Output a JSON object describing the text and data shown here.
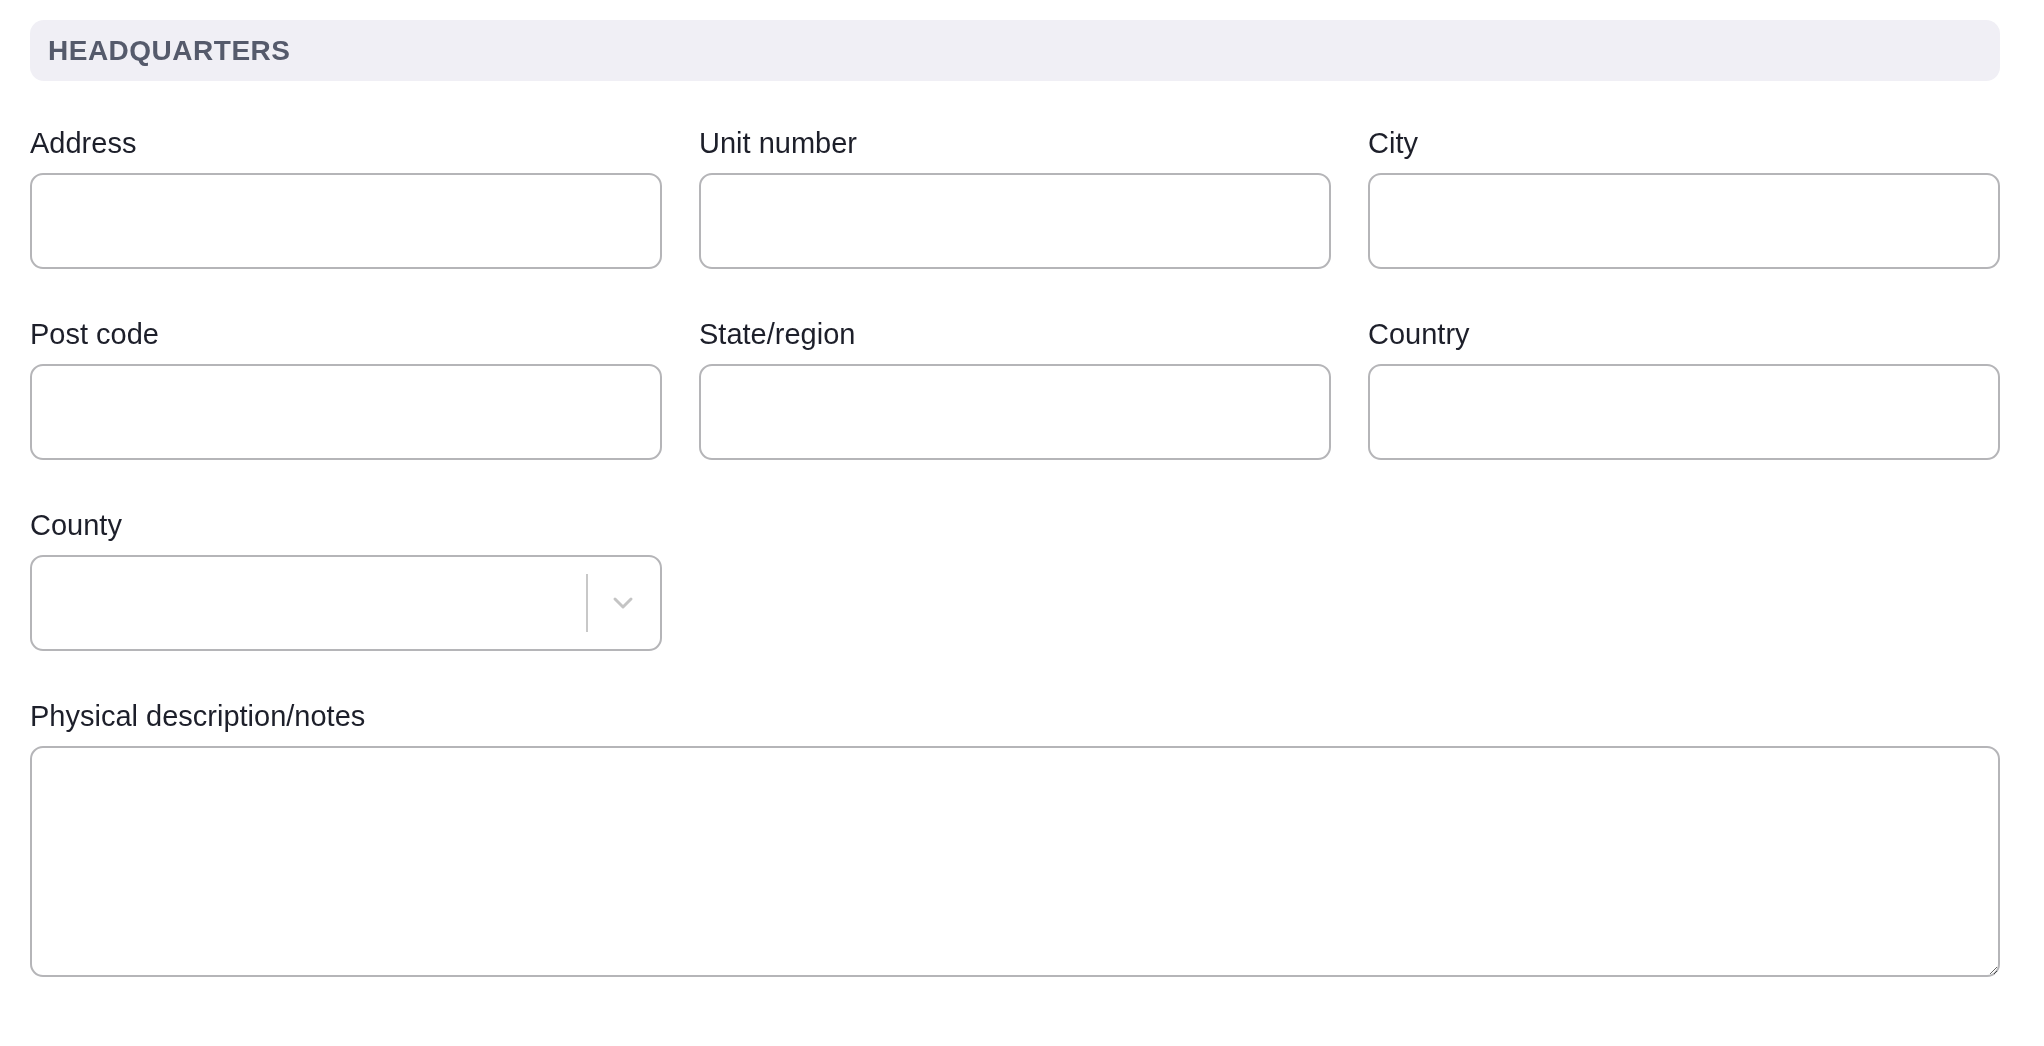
{
  "section": {
    "title": "HEADQUARTERS"
  },
  "fields": [
    {
      "kind": "input",
      "label": "Address"
    },
    {
      "kind": "input",
      "label": "Unit number"
    },
    {
      "kind": "input",
      "label": "City"
    },
    {
      "kind": "input",
      "label": "Post code"
    },
    {
      "kind": "input",
      "label": "State/region"
    },
    {
      "kind": "input",
      "label": "Country"
    },
    {
      "kind": "select",
      "label": "County"
    },
    {
      "kind": "textarea",
      "label": "Physical description/notes"
    }
  ]
}
